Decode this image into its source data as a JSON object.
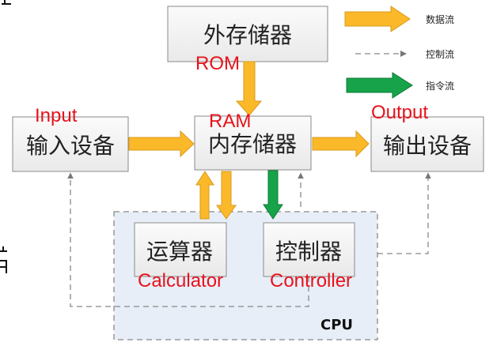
{
  "legend": {
    "data_flow": "数据流",
    "control_flow": "控制流",
    "instruction_flow": "指令流"
  },
  "colors": {
    "data_flow": "#fbb829",
    "instruction_flow": "#17a34a",
    "control_flow": "#888888",
    "annotation": "#e8121b",
    "cpu_fill": "#e8eef7"
  },
  "nodes": {
    "external_storage": {
      "label": "外存储器",
      "annotation": "ROM"
    },
    "input_device": {
      "label": "输入设备",
      "annotation": "Input"
    },
    "internal_storage": {
      "label": "内存储器",
      "annotation": "RAM"
    },
    "output_device": {
      "label": "输出设备",
      "annotation": "Output"
    },
    "alu": {
      "label": "运算器",
      "annotation": "Calculator"
    },
    "controller": {
      "label": "控制器",
      "annotation": "Controller"
    },
    "cpu": {
      "label": "CPU"
    }
  }
}
